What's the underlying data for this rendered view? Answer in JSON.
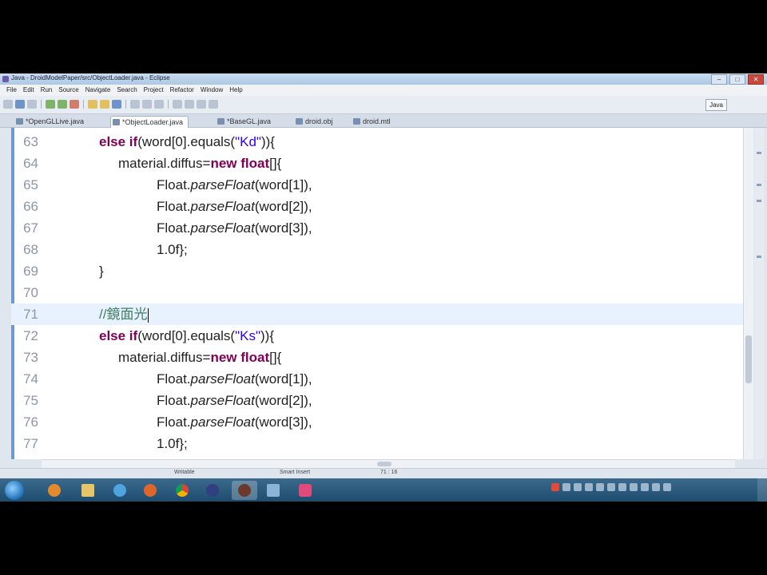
{
  "window": {
    "title": "Java - DroidModelPaper/src/ObjectLoader.java - Eclipse",
    "controls": [
      "–",
      "□",
      "✕"
    ]
  },
  "menu": [
    "File",
    "Edit",
    "Run",
    "Source",
    "Navigate",
    "Search",
    "Project",
    "Refactor",
    "Window",
    "Help"
  ],
  "toolbar": {
    "perspective_label": "Java"
  },
  "tabs": [
    {
      "label": "*OpenGLLive.java",
      "active": false
    },
    {
      "label": "*ObjectLoader.java",
      "active": true
    },
    {
      "label": "*BaseGL.java",
      "active": false
    },
    {
      "label": "droid.obj",
      "active": false
    },
    {
      "label": "droid.mtl",
      "active": false
    }
  ],
  "editor": {
    "lines": [
      {
        "num": "63",
        "parts": [
          [
            "",
            "else if"
          ],
          [
            "",
            "(word[0].equals("
          ],
          [
            "str",
            "\"Kd\""
          ],
          [
            "",
            ")){"
          ]
        ]
      },
      {
        "num": "64",
        "parts": [
          [
            "",
            "material.diffus="
          ],
          [
            "kw",
            "new float"
          ],
          [
            "",
            "[]{"
          ]
        ]
      },
      {
        "num": "65",
        "parts": [
          [
            "",
            "Float."
          ],
          [
            "it",
            "parseFloat"
          ],
          [
            "",
            "(word[1]),"
          ]
        ]
      },
      {
        "num": "66",
        "parts": [
          [
            "",
            "Float."
          ],
          [
            "it",
            "parseFloat"
          ],
          [
            "",
            "(word[2]),"
          ]
        ]
      },
      {
        "num": "67",
        "parts": [
          [
            "",
            "Float."
          ],
          [
            "it",
            "parseFloat"
          ],
          [
            "",
            "(word[3]),"
          ]
        ]
      },
      {
        "num": "68",
        "parts": [
          [
            "",
            "1.0f};"
          ]
        ]
      },
      {
        "num": "69",
        "parts": [
          [
            "",
            "}"
          ]
        ]
      },
      {
        "num": "70",
        "parts": []
      },
      {
        "num": "71",
        "parts": [
          [
            "cm",
            "//鏡面光"
          ]
        ]
      },
      {
        "num": "72",
        "parts": [
          [
            "",
            "else if"
          ],
          [
            "",
            "(word[0].equals("
          ],
          [
            "str",
            "\"Ks\""
          ],
          [
            "",
            ")){"
          ]
        ]
      },
      {
        "num": "73",
        "parts": [
          [
            "",
            "material.diffus="
          ],
          [
            "kw",
            "new float"
          ],
          [
            "",
            "[]{"
          ]
        ]
      },
      {
        "num": "74",
        "parts": [
          [
            "",
            "Float."
          ],
          [
            "it",
            "parseFloat"
          ],
          [
            "",
            "(word[1]),"
          ]
        ]
      },
      {
        "num": "75",
        "parts": [
          [
            "",
            "Float."
          ],
          [
            "it",
            "parseFloat"
          ],
          [
            "",
            "(word[2]),"
          ]
        ]
      },
      {
        "num": "76",
        "parts": [
          [
            "",
            "Float."
          ],
          [
            "it",
            "parseFloat"
          ],
          [
            "",
            "(word[3]),"
          ]
        ]
      },
      {
        "num": "77",
        "parts": [
          [
            "",
            "1.0f};"
          ]
        ]
      }
    ],
    "current_line": "71"
  },
  "status": {
    "writable": "Writable",
    "insert_mode": "Smart Insert",
    "position": "71 : 16"
  },
  "colors": {
    "keyword": "#7f0055",
    "string": "#2a00ff",
    "comment": "#3f7f5f",
    "current_line": "#e8f2fe"
  }
}
